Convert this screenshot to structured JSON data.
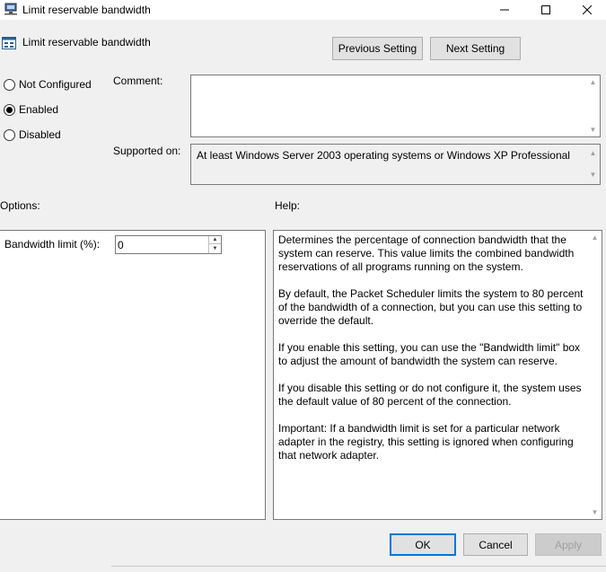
{
  "window": {
    "title": "Limit reservable bandwidth",
    "minimize_glyph": "—",
    "maximize_glyph": "☐",
    "close_glyph": "✕"
  },
  "header": {
    "title": "Limit reservable bandwidth",
    "prev_label": "Previous Setting",
    "next_label": "Next Setting"
  },
  "state": {
    "options": [
      {
        "label": "Not Configured",
        "selected": false
      },
      {
        "label": "Enabled",
        "selected": true
      },
      {
        "label": "Disabled",
        "selected": false
      }
    ]
  },
  "comment": {
    "label": "Comment:",
    "value": ""
  },
  "supported": {
    "label": "Supported on:",
    "value": "At least Windows Server 2003 operating systems or Windows XP Professional"
  },
  "options_panel": {
    "heading": "Options:",
    "bandwidth_label": "Bandwidth limit (%):",
    "bandwidth_value": "0"
  },
  "help_panel": {
    "heading": "Help:",
    "paragraphs": [
      "Determines the percentage of connection bandwidth that the system can reserve. This value limits the combined bandwidth reservations of all programs running on the system.",
      "By default, the Packet Scheduler limits the system to 80 percent of the bandwidth of a connection, but you can use this setting to override the default.",
      "If you enable this setting, you can use the \"Bandwidth limit\" box to adjust the amount of bandwidth the system can reserve.",
      "If you disable this setting or do not configure it, the system uses the default value of 80 percent of the connection.",
      "Important: If a bandwidth limit is set for a particular network adapter in the registry, this setting is ignored when configuring that network adapter."
    ]
  },
  "footer": {
    "ok_label": "OK",
    "cancel_label": "Cancel",
    "apply_label": "Apply"
  },
  "icons": {
    "title_icon": "network-policy-icon",
    "header_icon": "policy-setting-icon"
  },
  "colors": {
    "accent": "#0078d7",
    "background": "#f0f0f0"
  }
}
